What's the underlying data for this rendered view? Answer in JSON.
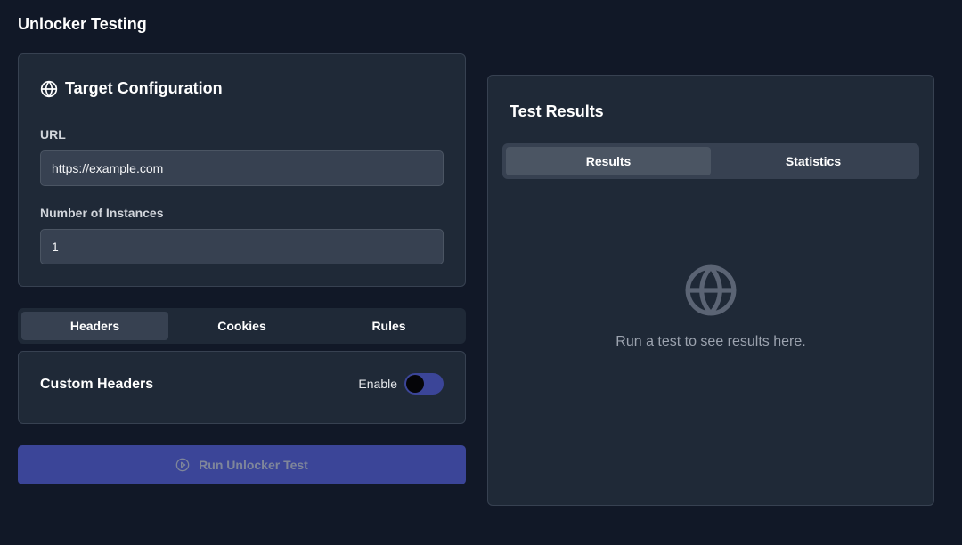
{
  "page": {
    "title": "Unlocker Testing"
  },
  "config": {
    "heading": "Target Configuration",
    "url_label": "URL",
    "url_value": "https://example.com",
    "instances_label": "Number of Instances",
    "instances_value": "1"
  },
  "left_tabs": [
    {
      "label": "Headers",
      "active": true
    },
    {
      "label": "Cookies",
      "active": false
    },
    {
      "label": "Rules",
      "active": false
    }
  ],
  "headers_panel": {
    "title": "Custom Headers",
    "enable_label": "Enable",
    "enabled": false
  },
  "run_button": {
    "label": "Run Unlocker Test",
    "icon": "play-circle-icon"
  },
  "results": {
    "title": "Test Results",
    "tabs": [
      {
        "label": "Results",
        "active": true
      },
      {
        "label": "Statistics",
        "active": false
      }
    ],
    "empty_text": "Run a test to see results here.",
    "empty_icon": "globe-icon"
  },
  "colors": {
    "background": "#111827",
    "card": "#1f2937",
    "accent": "#3b4598"
  }
}
